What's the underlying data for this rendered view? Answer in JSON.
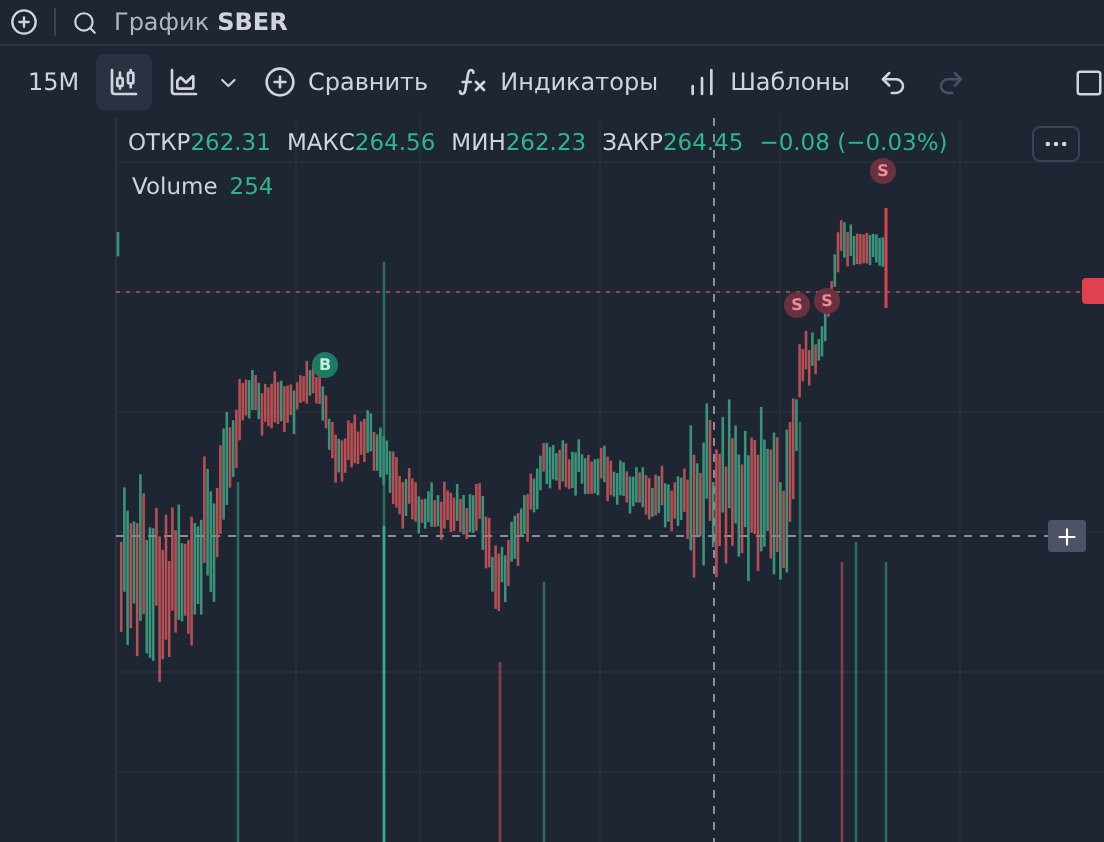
{
  "top_bar": {
    "title": "График",
    "symbol": "SBER"
  },
  "toolbar": {
    "interval": "15M",
    "chart_types": [
      {
        "kind": "candles",
        "selected": true
      },
      {
        "kind": "area",
        "selected": false
      }
    ],
    "buttons": [
      {
        "kind": "compare",
        "label": "Сравнить"
      },
      {
        "kind": "indicators",
        "label": "Индикаторы"
      },
      {
        "kind": "templates",
        "label": "Шаблоны"
      }
    ],
    "undo": {
      "disabled": false
    },
    "redo": {
      "disabled": true
    }
  },
  "legend": {
    "items": [
      {
        "label": "ОТКР",
        "value": "262.31"
      },
      {
        "label": "МАКС",
        "value": "264.56"
      },
      {
        "label": "МИН",
        "value": "262.23"
      },
      {
        "label": "ЗАКР",
        "value": "264.45"
      }
    ],
    "change": "−0.08 (−0.03%)",
    "volume": {
      "label": "Volume",
      "value": "254"
    }
  },
  "markers": [
    {
      "label": "B",
      "kind": "buy"
    },
    {
      "label": "S",
      "kind": "sell"
    },
    {
      "label": "S",
      "kind": "sell"
    },
    {
      "label": "S",
      "kind": "sell"
    }
  ]
}
